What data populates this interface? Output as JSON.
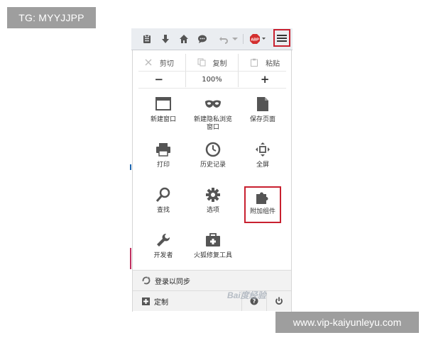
{
  "watermark_top_left": "TG: MYYJJPP",
  "watermark_bottom_right": "www.vip-kaiyunleyu.com",
  "toolbar": {
    "icons": [
      "clipboard-icon",
      "download-icon",
      "home-icon",
      "chat-icon",
      "undo-icon",
      "dropdown-icon",
      "adblock-icon",
      "hamburger-menu-icon"
    ],
    "adblock_label": "ABP"
  },
  "edit": {
    "cut": "剪切",
    "copy": "复制",
    "paste": "粘贴"
  },
  "zoom": {
    "minus": "−",
    "level": "100%",
    "plus": "+"
  },
  "items": [
    {
      "label": "新建窗口"
    },
    {
      "label": "新建隐私浏览窗口"
    },
    {
      "label": "保存页面"
    },
    {
      "label": "打印"
    },
    {
      "label": "历史记录"
    },
    {
      "label": "全屏"
    },
    {
      "label": "查找"
    },
    {
      "label": "选项"
    },
    {
      "label": "附加组件"
    },
    {
      "label": "开发者"
    },
    {
      "label": "火狐修复工具"
    }
  ],
  "footer": {
    "sync_label": "登录以同步",
    "customize_label": "定制",
    "help_label": "?"
  },
  "overlay_watermark": "Bai度经验",
  "colors": {
    "highlight": "#c8202f",
    "icon": "#555555",
    "toolbar_bg": "#eaedf1"
  }
}
